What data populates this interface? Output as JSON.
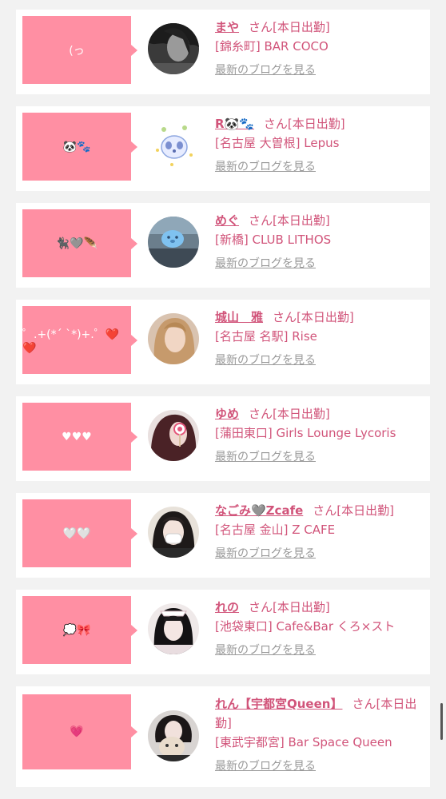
{
  "colors": {
    "bubble": "#ff8fa3",
    "text": "#d1547a",
    "link_gray": "#999999",
    "background": "#f2f2f2"
  },
  "entries": [
    {
      "bubble_text": "(っ",
      "name": "まや",
      "san": "さん[本日出勤]",
      "shop": "[錦糸町] BAR COCO",
      "blog": "最新のブログを見る",
      "avatar": "dark-hair-avatar"
    },
    {
      "bubble_text": "🐼🐾",
      "name": "R🐼🐾",
      "san": "さん[本日出勤]",
      "shop": "[名古屋 大曽根] Lepus",
      "blog": "最新のブログを見る",
      "avatar": "panda-avatar"
    },
    {
      "bubble_text": "🐈‍⬛🩶🪶",
      "name": "めぐ",
      "san": "さん[本日出勤]",
      "shop": "[新橋] CLUB LITHOS",
      "blog": "最新のブログを見る",
      "avatar": "blue-mask-avatar"
    },
    {
      "bubble_text": "゜.+(*´ `*)+.゜❤️❤️",
      "name": "城山　雅",
      "san": "さん[本日出勤]",
      "shop": "[名古屋 名駅] Rise",
      "blog": "最新のブログを見る",
      "avatar": "blonde-avatar"
    },
    {
      "bubble_text": "♥♥♥",
      "name": "ゆめ",
      "san": "さん[本日出勤]",
      "shop": "[蒲田東口] Girls Lounge Lycoris",
      "blog": "最新のブログを見る",
      "avatar": "lollipop-avatar"
    },
    {
      "bubble_text": "🤍🤍",
      "name": "なごみ🩶Zcafe",
      "san": "さん[本日出勤]",
      "shop": "[名古屋 金山] Z CAFE",
      "blog": "最新のブログを見る",
      "avatar": "mask-girl-avatar"
    },
    {
      "bubble_text": "💭🎀",
      "name": "れの",
      "san": "さん[本日出勤]",
      "shop": "[池袋東口] Cafe&Bar くろ×スト",
      "blog": "最新のブログを見る",
      "avatar": "maid-avatar"
    },
    {
      "bubble_text": "💗",
      "name": "れん【宇都宮Queen】",
      "san": "さん[本日出勤]",
      "shop": "[東武宇都宮] Bar Space Queen",
      "blog": "最新のブログを見る",
      "avatar": "plush-avatar"
    }
  ]
}
